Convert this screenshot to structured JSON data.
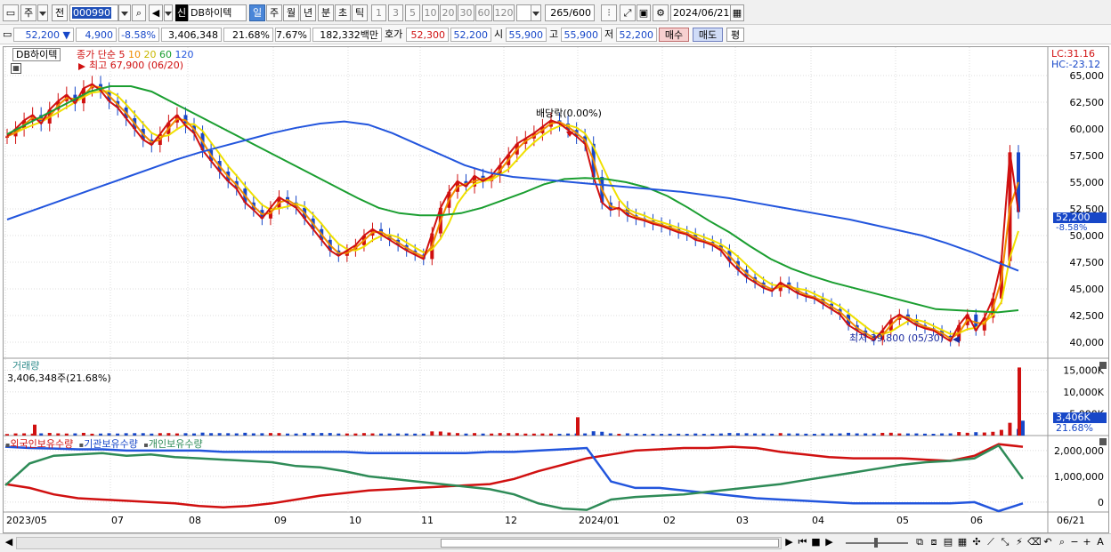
{
  "toolbar": {
    "market_type": "주",
    "prev_label": "전",
    "stock_code": "000990",
    "stock_name": "DB하이텍",
    "credit_badge": "신",
    "period_tabs": [
      "일",
      "주",
      "월",
      "년",
      "분",
      "초",
      "틱"
    ],
    "selected_period": "일",
    "intervals": [
      "1",
      "3",
      "5",
      "10",
      "20",
      "30",
      "60",
      "120"
    ],
    "count_display": "265",
    "count_total": "/600",
    "date": "2024/06/21"
  },
  "quote": {
    "price": "52,200",
    "change": "4,900",
    "change_pct": "-8.58%",
    "volume": "3,406,348",
    "vol_ratio": "21.68%",
    "turnover": "7.67%",
    "amount": "182,332백만",
    "ask_label": "호가",
    "ask": "52,300",
    "bid": "52,200",
    "open_label": "시",
    "open": "55,900",
    "high_label": "고",
    "high": "55,900",
    "low_label": "저",
    "low": "52,200",
    "buy_button": "매수",
    "sell_button": "매도",
    "avg_button": "평"
  },
  "price_pane": {
    "name_box": "DB하이텍",
    "legend_title": "종가 단순",
    "legend_periods": [
      "5",
      "10",
      "20",
      "60",
      "120"
    ],
    "legend_colors": [
      "#d01010",
      "#f08c00",
      "#f0e000",
      "#1a9e30",
      "#2255dd"
    ],
    "lc_label": "LC:31.16",
    "hc_label": "HC:-23.12",
    "high_annotation": "최고 67,900 (06/20)",
    "low_annotation": "최저 39,800 (05/30)",
    "dividend_annotation": "배당락(0.00%)",
    "current_price_tag": "52,200",
    "current_pct_tag": "-8.58%"
  },
  "volume_pane": {
    "title": "거래량",
    "value_text": "3,406,348주(21.68%)",
    "current_tag": "3,406K",
    "current_pct": "21.68%"
  },
  "holding_pane": {
    "series_labels": [
      "외국인보유수량",
      "기관보유수량",
      "개인보유수량"
    ],
    "series_colors": [
      "#d01010",
      "#2255dd",
      "#2e8b57"
    ]
  },
  "chart_data": [
    {
      "type": "line",
      "title": "DB하이텍",
      "x_ticks": [
        "2023/05",
        "07",
        "08",
        "09",
        "10",
        "11",
        "12",
        "2024/01",
        "02",
        "03",
        "04",
        "05",
        "06",
        "06/21"
      ],
      "y_ticks": [
        "65,000",
        "62,500",
        "60,000",
        "57,500",
        "55,000",
        "52,500",
        "50,000",
        "47,500",
        "45,000",
        "42,500",
        "40,000"
      ],
      "ylim": [
        38500,
        67500
      ],
      "close": [
        59300,
        60000,
        60800,
        61300,
        60500,
        61800,
        62600,
        63200,
        62400,
        63800,
        64200,
        63600,
        62600,
        62000,
        61000,
        60000,
        59000,
        58500,
        59500,
        60600,
        61300,
        60300,
        59600,
        58000,
        57000,
        56000,
        55100,
        54400,
        53100,
        52400,
        51600,
        52600,
        53600,
        53100,
        52600,
        51600,
        50600,
        49600,
        48600,
        48100,
        48600,
        49100,
        50000,
        50600,
        50100,
        49600,
        49100,
        48600,
        48200,
        47800,
        50200,
        52600,
        54100,
        55100,
        54600,
        55600,
        55100,
        55600,
        56600,
        57600,
        58600,
        59100,
        59600,
        60200,
        60800,
        60500,
        59900,
        59300,
        58600,
        55500,
        53100,
        52400,
        52600,
        51900,
        51600,
        51400,
        51100,
        50900,
        50600,
        50300,
        50100,
        49600,
        49400,
        49100,
        48600,
        47600,
        46800,
        46100,
        45600,
        45100,
        44800,
        45600,
        45100,
        44600,
        44300,
        44100,
        43600,
        43100,
        42600,
        41600,
        41100,
        40600,
        40200,
        41100,
        42100,
        42600,
        42100,
        41600,
        41300,
        41100,
        40600,
        40100,
        41600,
        42600,
        41100,
        42300,
        44100,
        47600,
        57800,
        52200
      ],
      "ma5_color": "#d01010",
      "ma10_color": "#f08c00",
      "ma20_color": "#f0e000",
      "ma60": [
        59500,
        60500,
        61500,
        62500,
        63500,
        64000,
        64000,
        63500,
        62500,
        61500,
        60500,
        59500,
        58500,
        57500,
        56500,
        55500,
        54500,
        53500,
        52600,
        52100,
        51900,
        51900,
        52100,
        52600,
        53300,
        54000,
        54800,
        55300,
        55400,
        55300,
        55000,
        54500,
        53700,
        52600,
        51400,
        50300,
        49000,
        47800,
        46900,
        46200,
        45600,
        45100,
        44600,
        44100,
        43600,
        43100,
        43000,
        42900,
        42800,
        43000
      ],
      "ma120": [
        51500,
        52300,
        53100,
        53900,
        54700,
        55500,
        56300,
        57100,
        57800,
        58400,
        59000,
        59600,
        60100,
        60500,
        60700,
        60400,
        59600,
        58600,
        57600,
        56600,
        55900,
        55500,
        55300,
        55100,
        54900,
        54700,
        54500,
        54300,
        54100,
        53800,
        53500,
        53100,
        52700,
        52300,
        51900,
        51500,
        51000,
        50500,
        50000,
        49300,
        48500,
        47600,
        46700
      ],
      "ma60_color": "#1a9e30",
      "ma120_color": "#2255dd"
    },
    {
      "type": "bar",
      "title": "거래량",
      "y_ticks": [
        "15,000K",
        "10,000K",
        "5,000K"
      ],
      "ylim": [
        0,
        16500000
      ],
      "highlight_values": [
        3406348,
        15600000,
        4200000,
        2500000
      ]
    },
    {
      "type": "line",
      "title": "외국인보유수량 / 기관보유수량 / 개인보유수량",
      "y_ticks": [
        "2,000,000",
        "1,000,000",
        "0"
      ],
      "ylim": [
        -350000,
        2550000
      ],
      "series": [
        {
          "name": "외국인보유수량",
          "color": "#d01010",
          "values": [
            700000,
            550000,
            300000,
            150000,
            100000,
            50000,
            0,
            -50000,
            -150000,
            -200000,
            -150000,
            -50000,
            100000,
            250000,
            350000,
            450000,
            500000,
            550000,
            600000,
            650000,
            700000,
            900000,
            1200000,
            1450000,
            1700000,
            1850000,
            2000000,
            2050000,
            2100000,
            2100000,
            2150000,
            2100000,
            1950000,
            1850000,
            1750000,
            1700000,
            1700000,
            1700000,
            1650000,
            1600000,
            1800000,
            2250000,
            2150000
          ]
        },
        {
          "name": "기관보유수량",
          "color": "#2255dd",
          "values": [
            2150000,
            2100000,
            2080000,
            2050000,
            2050000,
            2000000,
            2000000,
            2000000,
            2000000,
            1950000,
            1950000,
            1950000,
            1950000,
            1950000,
            1950000,
            1900000,
            1900000,
            1900000,
            1900000,
            1900000,
            1950000,
            1950000,
            2000000,
            2050000,
            2100000,
            800000,
            550000,
            550000,
            450000,
            350000,
            250000,
            150000,
            100000,
            50000,
            0,
            -50000,
            -50000,
            -50000,
            -50000,
            -50000,
            0,
            -350000,
            -50000
          ]
        },
        {
          "name": "개인보유수량",
          "color": "#2e8b57",
          "values": [
            650000,
            1500000,
            1800000,
            1850000,
            1900000,
            1800000,
            1850000,
            1750000,
            1700000,
            1650000,
            1600000,
            1550000,
            1400000,
            1350000,
            1200000,
            1000000,
            900000,
            800000,
            700000,
            600000,
            500000,
            300000,
            -50000,
            -250000,
            -300000,
            100000,
            200000,
            250000,
            300000,
            400000,
            500000,
            600000,
            700000,
            850000,
            1000000,
            1150000,
            1300000,
            1450000,
            1550000,
            1600000,
            1700000,
            2200000,
            900000
          ]
        }
      ]
    }
  ]
}
